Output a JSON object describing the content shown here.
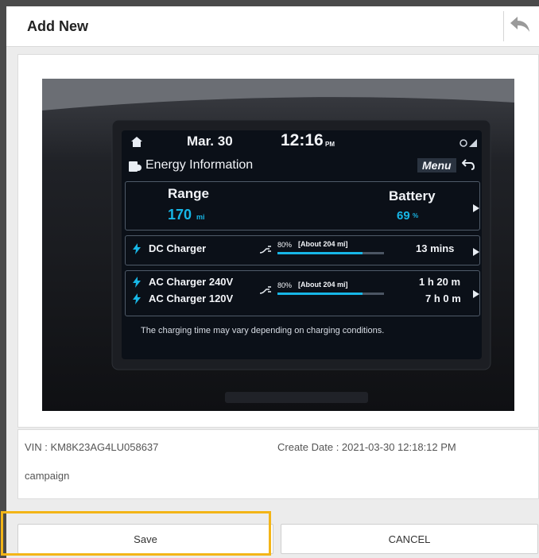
{
  "header": {
    "title": "Add New",
    "back_icon": "reply-arrow-icon"
  },
  "photo": {
    "screen": {
      "date": "Mar. 30",
      "time": "12:16",
      "time_suffix": "PM",
      "section_title": "Energy Information",
      "menu_label": "Menu",
      "range_label": "Range",
      "range_value": "170",
      "range_unit": "mi",
      "battery_label": "Battery",
      "battery_value": "69",
      "battery_unit": "%",
      "dc_label": "DC Charger",
      "dc_percent": "80%",
      "dc_range": "[About 204 mi]",
      "dc_time": "13 mins",
      "ac240_label": "AC Charger 240V",
      "ac120_label": "AC Charger 120V",
      "ac_percent": "80%",
      "ac_range": "[About 204 mi]",
      "ac240_time": "1 h 20 m",
      "ac120_time": "7 h 0 m",
      "note": "The charging time may vary depending on charging conditions.",
      "dc_progress": 0.8,
      "ac_progress": 0.8
    }
  },
  "info": {
    "vin": "VIN : KM8K23AG4LU058637",
    "create_date": "Create Date : 2021-03-30 12:18:12 PM",
    "note": "campaign"
  },
  "actions": {
    "save_label": "Save",
    "cancel_label": "CANCEL"
  },
  "colors": {
    "accent_highlight": "#f3b517",
    "screen_cyan": "#17b6e6"
  }
}
